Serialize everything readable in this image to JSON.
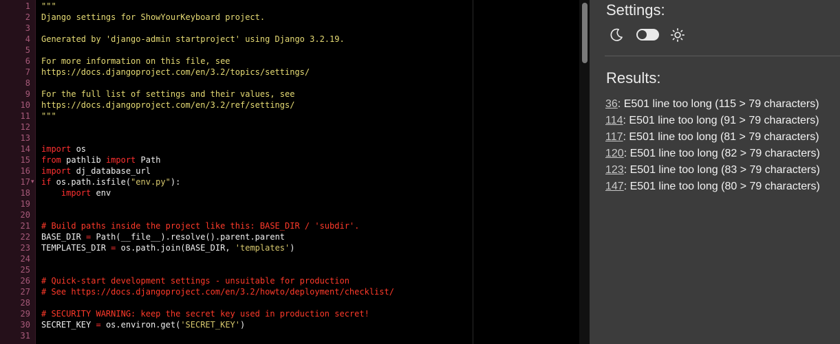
{
  "editor": {
    "lines": [
      {
        "n": 1,
        "tokens": [
          {
            "t": "\"\"\"",
            "c": "str"
          }
        ]
      },
      {
        "n": 2,
        "tokens": [
          {
            "t": "Django settings for ShowYourKeyboard project.",
            "c": "str"
          }
        ]
      },
      {
        "n": 3,
        "tokens": []
      },
      {
        "n": 4,
        "tokens": [
          {
            "t": "Generated by 'django-admin startproject' using Django 3.2.19.",
            "c": "str"
          }
        ]
      },
      {
        "n": 5,
        "tokens": []
      },
      {
        "n": 6,
        "tokens": [
          {
            "t": "For more information on this file, see",
            "c": "str"
          }
        ]
      },
      {
        "n": 7,
        "tokens": [
          {
            "t": "https://docs.djangoproject.com/en/3.2/topics/settings/",
            "c": "str"
          }
        ]
      },
      {
        "n": 8,
        "tokens": []
      },
      {
        "n": 9,
        "tokens": [
          {
            "t": "For the full list of settings and their values, see",
            "c": "str"
          }
        ]
      },
      {
        "n": 10,
        "tokens": [
          {
            "t": "https://docs.djangoproject.com/en/3.2/ref/settings/",
            "c": "str"
          }
        ]
      },
      {
        "n": 11,
        "tokens": [
          {
            "t": "\"\"\"",
            "c": "str"
          }
        ]
      },
      {
        "n": 12,
        "tokens": []
      },
      {
        "n": 13,
        "tokens": []
      },
      {
        "n": 14,
        "tokens": [
          {
            "t": "import",
            "c": "kw"
          },
          {
            "t": " os",
            "c": "id"
          }
        ]
      },
      {
        "n": 15,
        "tokens": [
          {
            "t": "from",
            "c": "kw"
          },
          {
            "t": " pathlib ",
            "c": "id"
          },
          {
            "t": "import",
            "c": "kw"
          },
          {
            "t": " Path",
            "c": "id"
          }
        ]
      },
      {
        "n": 16,
        "tokens": [
          {
            "t": "import",
            "c": "kw"
          },
          {
            "t": " dj_database_url",
            "c": "id"
          }
        ]
      },
      {
        "n": 17,
        "fold": true,
        "tokens": [
          {
            "t": "if",
            "c": "kw"
          },
          {
            "t": " os.path.isfile(",
            "c": "id"
          },
          {
            "t": "\"env.py\"",
            "c": "str2"
          },
          {
            "t": "):",
            "c": "id"
          }
        ]
      },
      {
        "n": 18,
        "tokens": [
          {
            "t": "    ",
            "c": "id"
          },
          {
            "t": "import",
            "c": "kw"
          },
          {
            "t": " env",
            "c": "id"
          }
        ]
      },
      {
        "n": 19,
        "tokens": []
      },
      {
        "n": 20,
        "tokens": []
      },
      {
        "n": 21,
        "tokens": [
          {
            "t": "# Build paths inside the project like this: BASE_DIR / 'subdir'.",
            "c": "com"
          }
        ]
      },
      {
        "n": 22,
        "tokens": [
          {
            "t": "BASE_DIR ",
            "c": "id"
          },
          {
            "t": "=",
            "c": "op"
          },
          {
            "t": " Path(__file__).resolve().parent.parent",
            "c": "id"
          }
        ]
      },
      {
        "n": 23,
        "tokens": [
          {
            "t": "TEMPLATES_DIR ",
            "c": "id"
          },
          {
            "t": "=",
            "c": "op"
          },
          {
            "t": " os.path.join(BASE_DIR, ",
            "c": "id"
          },
          {
            "t": "'templates'",
            "c": "str2"
          },
          {
            "t": ")",
            "c": "id"
          }
        ]
      },
      {
        "n": 24,
        "tokens": []
      },
      {
        "n": 25,
        "tokens": []
      },
      {
        "n": 26,
        "tokens": [
          {
            "t": "# Quick-start development settings - unsuitable for production",
            "c": "com"
          }
        ]
      },
      {
        "n": 27,
        "tokens": [
          {
            "t": "# See https://docs.djangoproject.com/en/3.2/howto/deployment/checklist/",
            "c": "com"
          }
        ]
      },
      {
        "n": 28,
        "tokens": []
      },
      {
        "n": 29,
        "tokens": [
          {
            "t": "# SECURITY WARNING: keep the secret key used in production secret!",
            "c": "com"
          }
        ]
      },
      {
        "n": 30,
        "tokens": [
          {
            "t": "SECRET_KEY ",
            "c": "id"
          },
          {
            "t": "=",
            "c": "op"
          },
          {
            "t": " os.environ.get(",
            "c": "id"
          },
          {
            "t": "'SECRET_KEY'",
            "c": "str2"
          },
          {
            "t": ")",
            "c": "id"
          }
        ]
      },
      {
        "n": 31,
        "tokens": []
      }
    ]
  },
  "panel": {
    "settings_title": "Settings:",
    "results_title": "Results:",
    "results": [
      {
        "line": "36",
        "message": ": E501 line too long (115 > 79 characters)"
      },
      {
        "line": "114",
        "message": ": E501 line too long (91 > 79 characters)"
      },
      {
        "line": "117",
        "message": ": E501 line too long (81 > 79 characters)"
      },
      {
        "line": "120",
        "message": ": E501 line too long (82 > 79 characters)"
      },
      {
        "line": "123",
        "message": ": E501 line too long (83 > 79 characters)"
      },
      {
        "line": "147",
        "message": ": E501 line too long (80 > 79 characters)"
      }
    ],
    "icons": {
      "moon": "moon-icon",
      "sun": "sun-icon"
    }
  }
}
